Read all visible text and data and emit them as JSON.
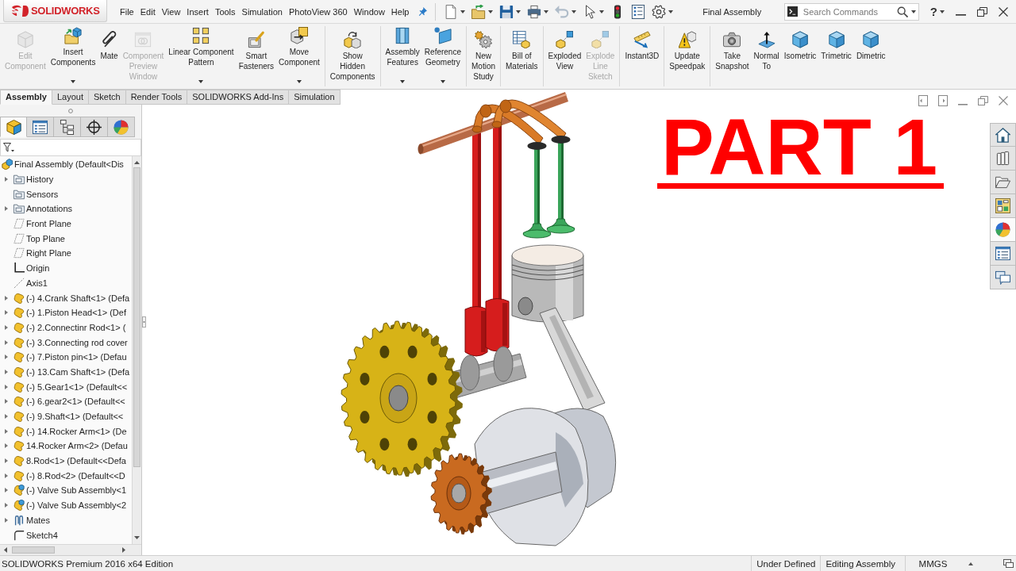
{
  "app": {
    "logo": "SOLIDWORKS",
    "menu": [
      "File",
      "Edit",
      "View",
      "Insert",
      "Tools",
      "Simulation",
      "PhotoView 360",
      "Window",
      "Help"
    ],
    "quick_access": [
      {
        "dropdown": true,
        "disabled": false
      },
      {
        "dropdown": true,
        "disabled": false
      },
      {
        "dropdown": true,
        "disabled": false
      },
      {
        "dropdown": true,
        "disabled": false
      },
      {
        "dropdown": true,
        "disabled": true
      },
      {
        "dropdown": true,
        "disabled": false
      },
      {
        "dropdown": false,
        "disabled": false
      },
      {
        "dropdown": false,
        "disabled": false
      },
      {
        "dropdown": true,
        "disabled": false
      }
    ],
    "title": "Final Assembly",
    "search": {
      "placeholder": "Search Commands"
    },
    "help": "?"
  },
  "ribbon": {
    "groups": [
      {
        "buttons": [
          {
            "label": "Edit\nComponent",
            "disabled": true,
            "dropdown": false
          },
          {
            "label": "Insert\nComponents",
            "disabled": false,
            "dropdown": true
          },
          {
            "label": "Mate",
            "disabled": false,
            "dropdown": false
          },
          {
            "label": "Component\nPreview\nWindow",
            "disabled": true,
            "dropdown": false
          },
          {
            "label": "Linear Component\nPattern",
            "disabled": false,
            "dropdown": true
          },
          {
            "label": "Smart\nFasteners",
            "disabled": false,
            "dropdown": false
          },
          {
            "label": "Move\nComponent",
            "disabled": false,
            "dropdown": true
          }
        ]
      },
      {
        "buttons": [
          {
            "label": "Show\nHidden\nComponents",
            "disabled": false,
            "dropdown": false
          }
        ]
      },
      {
        "buttons": [
          {
            "label": "Assembly\nFeatures",
            "disabled": false,
            "dropdown": true
          },
          {
            "label": "Reference\nGeometry",
            "disabled": false,
            "dropdown": true
          }
        ]
      },
      {
        "buttons": [
          {
            "label": "New\nMotion\nStudy",
            "disabled": false,
            "dropdown": false
          }
        ]
      },
      {
        "buttons": [
          {
            "label": "Bill of\nMaterials",
            "disabled": false,
            "dropdown": false
          }
        ]
      },
      {
        "buttons": [
          {
            "label": "Exploded\nView",
            "disabled": false,
            "dropdown": false
          },
          {
            "label": "Explode\nLine\nSketch",
            "disabled": true,
            "dropdown": false
          }
        ]
      },
      {
        "buttons": [
          {
            "label": "Instant3D",
            "disabled": false,
            "dropdown": false
          }
        ]
      },
      {
        "buttons": [
          {
            "label": "Update\nSpeedpak",
            "disabled": false,
            "dropdown": false
          }
        ]
      },
      {
        "buttons": [
          {
            "label": "Take\nSnapshot",
            "disabled": false,
            "dropdown": false
          },
          {
            "label": "Normal\nTo",
            "disabled": false,
            "dropdown": false
          },
          {
            "label": "Isometric",
            "disabled": false,
            "dropdown": false
          },
          {
            "label": "Trimetric",
            "disabled": false,
            "dropdown": false
          },
          {
            "label": "Dimetric",
            "disabled": false,
            "dropdown": false
          }
        ]
      }
    ]
  },
  "command_tabs": [
    {
      "label": "Assembly",
      "selected": true
    },
    {
      "label": "Layout",
      "selected": false
    },
    {
      "label": "Sketch",
      "selected": false
    },
    {
      "label": "Render Tools",
      "selected": false
    },
    {
      "label": "SOLIDWORKS Add-Ins",
      "selected": false
    },
    {
      "label": "Simulation",
      "selected": false
    }
  ],
  "feature_manager": {
    "tabs": [
      {
        "selected": true
      },
      {
        "selected": false
      },
      {
        "selected": false
      },
      {
        "selected": false
      },
      {
        "selected": false
      }
    ],
    "tree": {
      "label": "Final Assembly  (Default<Dis",
      "kind": "assembly",
      "children": [
        {
          "label": "History",
          "kind": "folder",
          "expandable": true
        },
        {
          "label": "Sensors",
          "kind": "folder",
          "expandable": false
        },
        {
          "label": "Annotations",
          "kind": "folder",
          "expandable": true
        },
        {
          "label": "Front Plane",
          "kind": "plane",
          "expandable": false
        },
        {
          "label": "Top Plane",
          "kind": "plane",
          "expandable": false
        },
        {
          "label": "Right Plane",
          "kind": "plane",
          "expandable": false
        },
        {
          "label": "Origin",
          "kind": "origin",
          "expandable": false
        },
        {
          "label": "Axis1",
          "kind": "axis",
          "expandable": false
        },
        {
          "label": "(-) 4.Crank Shaft<1> (Defa",
          "kind": "part",
          "expandable": true
        },
        {
          "label": "(-) 1.Piston Head<1> (Def",
          "kind": "part",
          "expandable": true
        },
        {
          "label": "(-) 2.Connectinr Rod<1> (",
          "kind": "part",
          "expandable": true
        },
        {
          "label": "(-) 3.Connecting rod cover",
          "kind": "part",
          "expandable": true
        },
        {
          "label": "(-) 7.Piston pin<1> (Defau",
          "kind": "part",
          "expandable": true
        },
        {
          "label": "(-) 13.Cam Shaft<1> (Defa",
          "kind": "part",
          "expandable": true
        },
        {
          "label": "(-) 5.Gear1<1> (Default<<",
          "kind": "part",
          "expandable": true
        },
        {
          "label": "(-) 6.gear2<1> (Default<<",
          "kind": "part",
          "expandable": true
        },
        {
          "label": "(-) 9.Shaft<1> (Default<<",
          "kind": "part",
          "expandable": true
        },
        {
          "label": "(-) 14.Rocker Arm<1> (De",
          "kind": "part",
          "expandable": true
        },
        {
          "label": "14.Rocker Arm<2> (Defau",
          "kind": "part",
          "expandable": true
        },
        {
          "label": "8.Rod<1> (Default<<Defa",
          "kind": "part",
          "expandable": true
        },
        {
          "label": "(-) 8.Rod<2> (Default<<D",
          "kind": "part",
          "expandable": true
        },
        {
          "label": "(-) Valve Sub Assembly<1",
          "kind": "subassembly",
          "expandable": true
        },
        {
          "label": "(-) Valve Sub Assembly<2",
          "kind": "subassembly",
          "expandable": true
        },
        {
          "label": "Mates",
          "kind": "mates",
          "expandable": true
        },
        {
          "label": "Sketch4",
          "kind": "sketch",
          "expandable": false
        }
      ]
    }
  },
  "viewport": {
    "annotation": "PART 1"
  },
  "task_pane": [
    {
      "selected": false
    },
    {
      "selected": false
    },
    {
      "selected": false
    },
    {
      "selected": false
    },
    {
      "selected": true
    },
    {
      "selected": false
    },
    {
      "selected": false
    }
  ],
  "status_bar": {
    "product": "SOLIDWORKS Premium 2016 x64 Edition",
    "fields": [
      "Under Defined",
      "Editing Assembly",
      "MMGS"
    ]
  }
}
